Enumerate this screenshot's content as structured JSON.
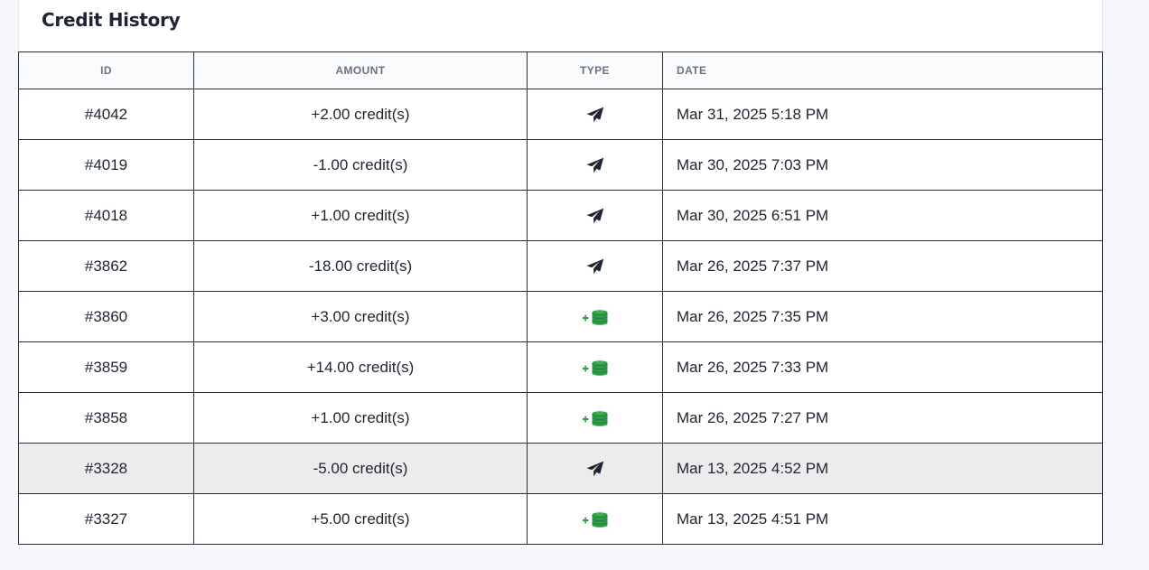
{
  "card": {
    "title": "Credit History"
  },
  "table": {
    "columns": {
      "id": "ID",
      "amount": "AMOUNT",
      "type": "TYPE",
      "date": "DATE"
    },
    "rows": [
      {
        "id": "#4042",
        "amount": "+2.00 credit(s)",
        "sign": "positive",
        "type_icon": "paper-plane-icon",
        "date": "Mar 31, 2025 5:18 PM"
      },
      {
        "id": "#4019",
        "amount": "-1.00 credit(s)",
        "sign": "negative",
        "type_icon": "paper-plane-icon",
        "date": "Mar 30, 2025 7:03 PM"
      },
      {
        "id": "#4018",
        "amount": "+1.00 credit(s)",
        "sign": "positive",
        "type_icon": "paper-plane-icon",
        "date": "Mar 30, 2025 6:51 PM"
      },
      {
        "id": "#3862",
        "amount": "-18.00 credit(s)",
        "sign": "negative",
        "type_icon": "paper-plane-icon",
        "date": "Mar 26, 2025 7:37 PM"
      },
      {
        "id": "#3860",
        "amount": "+3.00 credit(s)",
        "sign": "positive",
        "type_icon": "add-coins-icon",
        "date": "Mar 26, 2025 7:35 PM"
      },
      {
        "id": "#3859",
        "amount": "+14.00 credit(s)",
        "sign": "positive",
        "type_icon": "add-coins-icon",
        "date": "Mar 26, 2025 7:33 PM"
      },
      {
        "id": "#3858",
        "amount": "+1.00 credit(s)",
        "sign": "positive",
        "type_icon": "add-coins-icon",
        "date": "Mar 26, 2025 7:27 PM"
      },
      {
        "id": "#3328",
        "amount": "-5.00 credit(s)",
        "sign": "negative",
        "type_icon": "paper-plane-icon",
        "date": "Mar 13, 2025 4:52 PM",
        "highlighted": true
      },
      {
        "id": "#3327",
        "amount": "+5.00 credit(s)",
        "sign": "positive",
        "type_icon": "add-coins-icon",
        "date": "Mar 13, 2025 4:51 PM"
      }
    ]
  },
  "colors": {
    "positive": "#2e9d47",
    "negative": "#c9343a",
    "plane_icon": "#1d2433",
    "coins_icon": "#2e9d47",
    "highlight_row": "#ececec"
  }
}
